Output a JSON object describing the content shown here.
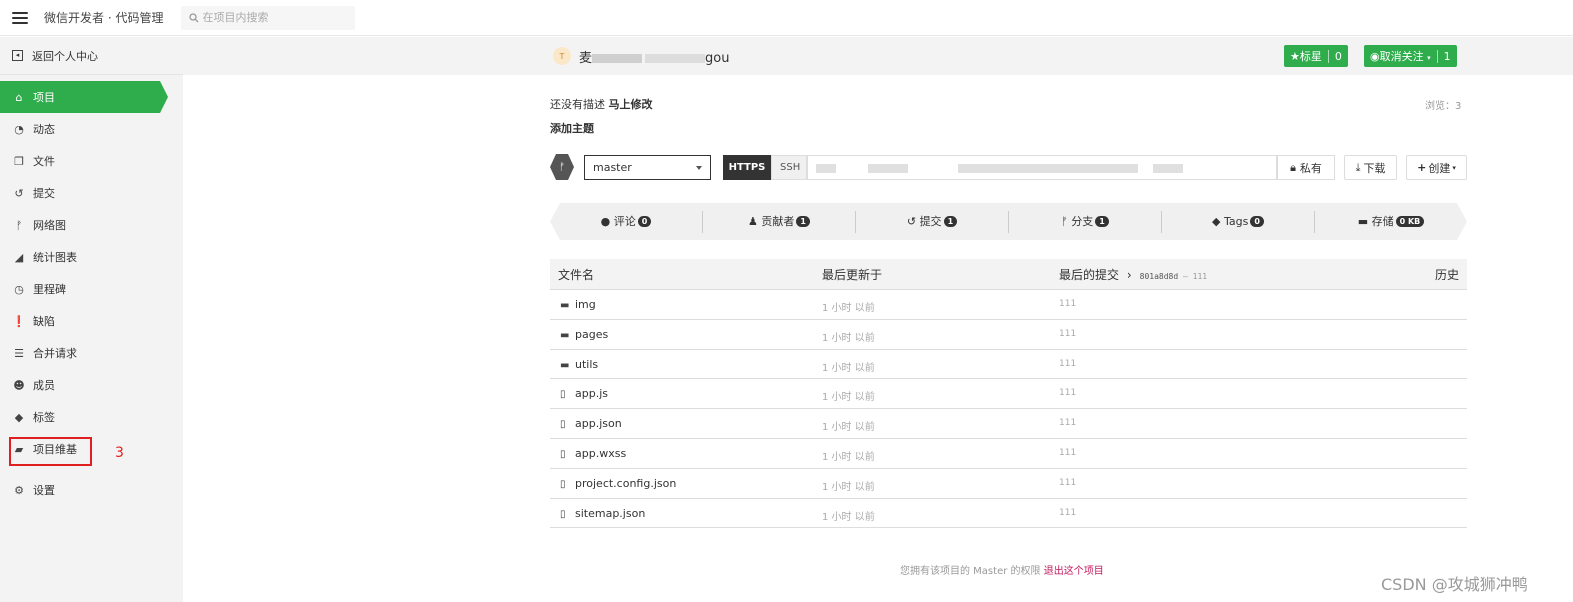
{
  "topbar": {
    "app_title": "微信开发者 · 代码管理",
    "search_placeholder": "在项目内搜索"
  },
  "sidebar": {
    "back_label": "返回个人中心",
    "items": [
      {
        "label": "项目",
        "icon": "home-icon",
        "active": true
      },
      {
        "label": "动态",
        "icon": "dashboard-icon"
      },
      {
        "label": "文件",
        "icon": "files-icon"
      },
      {
        "label": "提交",
        "icon": "history-icon"
      },
      {
        "label": "网络图",
        "icon": "branch-icon"
      },
      {
        "label": "统计图表",
        "icon": "area-chart-icon"
      },
      {
        "label": "里程碑",
        "icon": "clock-icon"
      },
      {
        "label": "缺陷",
        "icon": "exclamation-icon"
      },
      {
        "label": "合并请求",
        "icon": "list-icon"
      },
      {
        "label": "成员",
        "icon": "users-icon"
      },
      {
        "label": "标签",
        "icon": "tags-icon"
      },
      {
        "label": "项目维基",
        "icon": "book-icon"
      },
      {
        "label": "设置",
        "icon": "cogs-icon"
      }
    ],
    "annotation": "3"
  },
  "project": {
    "avatar_letter": "T",
    "name_prefix": "麦",
    "name_suffix": "gou",
    "star_label": "标星",
    "star_count": "0",
    "watch_label": "取消关注",
    "watch_count": "1",
    "no_desc": "还没有描述",
    "edit_now": "马上修改",
    "add_topic": "添加主题",
    "views_label": "浏览：",
    "views_count": "3"
  },
  "repo": {
    "branch": "master",
    "https_label": "HTTPS",
    "ssh_label": "SSH",
    "private_label": "私有",
    "download_label": "下载",
    "create_label": "创建"
  },
  "stats": [
    {
      "label": "评论",
      "count": "0",
      "icon": "comment-icon"
    },
    {
      "label": "贡献者",
      "count": "1",
      "icon": "user-icon"
    },
    {
      "label": "提交",
      "count": "1",
      "icon": "history-icon"
    },
    {
      "label": "分支",
      "count": "1",
      "icon": "branch-icon"
    },
    {
      "label": "Tags",
      "count": "0",
      "icon": "tag-icon"
    },
    {
      "label": "存储",
      "count": "0 KB",
      "icon": "folder-icon"
    }
  ],
  "files": {
    "headers": {
      "name": "文件名",
      "updated": "最后更新于",
      "last_commit": "最后的提交",
      "history": "历史"
    },
    "commit_sha": "801a8d8d",
    "commit_msg": "111",
    "rows": [
      {
        "name": "img",
        "type": "folder",
        "updated": "1 小时 以前",
        "msg": "111"
      },
      {
        "name": "pages",
        "type": "folder",
        "updated": "1 小时 以前",
        "msg": "111"
      },
      {
        "name": "utils",
        "type": "folder",
        "updated": "1 小时 以前",
        "msg": "111"
      },
      {
        "name": "app.js",
        "type": "file",
        "updated": "1 小时 以前",
        "msg": "111"
      },
      {
        "name": "app.json",
        "type": "file",
        "updated": "1 小时 以前",
        "msg": "111"
      },
      {
        "name": "app.wxss",
        "type": "file",
        "updated": "1 小时 以前",
        "msg": "111"
      },
      {
        "name": "project.config.json",
        "type": "file",
        "updated": "1 小时 以前",
        "msg": "111"
      },
      {
        "name": "sitemap.json",
        "type": "file",
        "updated": "1 小时 以前",
        "msg": "111"
      }
    ]
  },
  "footer": {
    "text": "您拥有该项目的 Master 的权限",
    "leave_link": "退出这个项目"
  },
  "watermark": "CSDN @攻城狮冲鸭"
}
